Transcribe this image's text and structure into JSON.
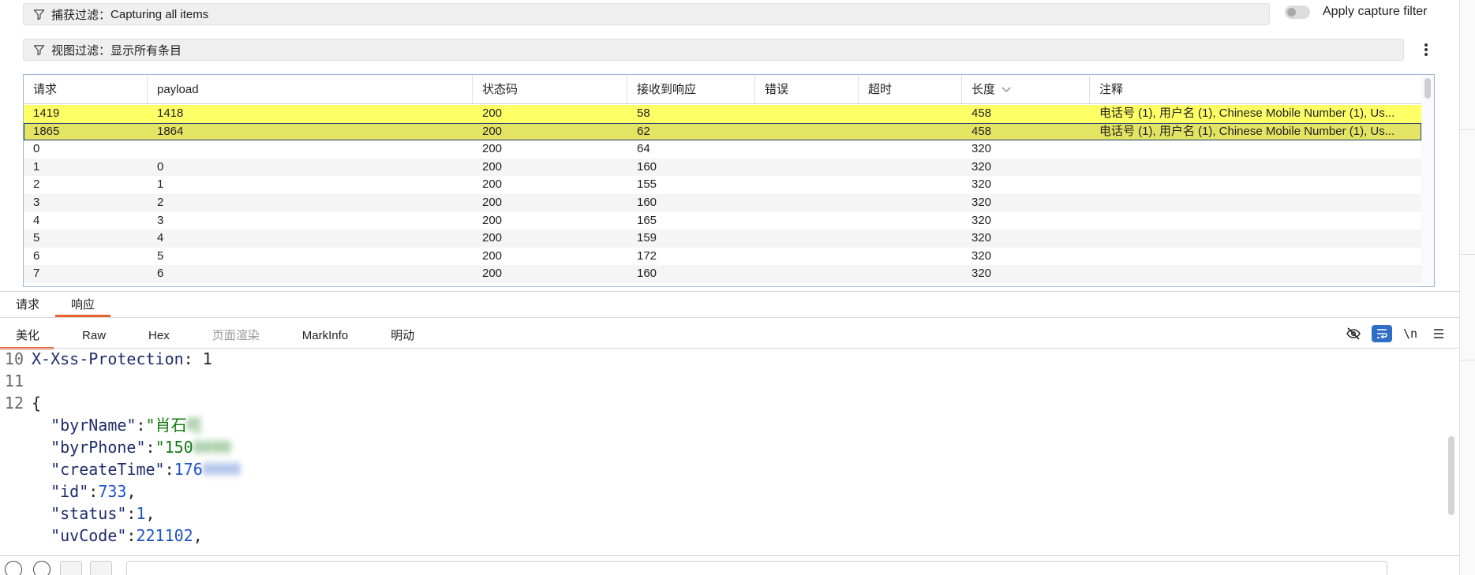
{
  "capture_filter": {
    "label": "捕获过滤：",
    "value": "Capturing all items"
  },
  "apply_capture_filter": {
    "label": "Apply capture filter"
  },
  "view_filter": {
    "label": "视图过滤：",
    "value": "显示所有条目"
  },
  "table": {
    "headers": [
      "请求",
      "payload",
      "状态码",
      "接收到响应",
      "错误",
      "超时",
      "长度",
      "注释"
    ],
    "sort_column": "长度",
    "rows": [
      {
        "req": "1419",
        "payload": "1418",
        "status": "200",
        "resp": "58",
        "err": "",
        "timeout": "",
        "len": "458",
        "note": "电话号 (1), 用户名 (1), Chinese Mobile Number (1), Us...",
        "style": "hl"
      },
      {
        "req": "1865",
        "payload": "1864",
        "status": "200",
        "resp": "62",
        "err": "",
        "timeout": "",
        "len": "458",
        "note": "电话号 (1), 用户名 (1), Chinese Mobile Number (1), Us...",
        "style": "sel"
      },
      {
        "req": "0",
        "payload": "",
        "status": "200",
        "resp": "64",
        "err": "",
        "timeout": "",
        "len": "320",
        "note": "",
        "style": ""
      },
      {
        "req": "1",
        "payload": "0",
        "status": "200",
        "resp": "160",
        "err": "",
        "timeout": "",
        "len": "320",
        "note": "",
        "style": ""
      },
      {
        "req": "2",
        "payload": "1",
        "status": "200",
        "resp": "155",
        "err": "",
        "timeout": "",
        "len": "320",
        "note": "",
        "style": ""
      },
      {
        "req": "3",
        "payload": "2",
        "status": "200",
        "resp": "160",
        "err": "",
        "timeout": "",
        "len": "320",
        "note": "",
        "style": ""
      },
      {
        "req": "4",
        "payload": "3",
        "status": "200",
        "resp": "165",
        "err": "",
        "timeout": "",
        "len": "320",
        "note": "",
        "style": ""
      },
      {
        "req": "5",
        "payload": "4",
        "status": "200",
        "resp": "159",
        "err": "",
        "timeout": "",
        "len": "320",
        "note": "",
        "style": ""
      },
      {
        "req": "6",
        "payload": "5",
        "status": "200",
        "resp": "172",
        "err": "",
        "timeout": "",
        "len": "320",
        "note": "",
        "style": ""
      },
      {
        "req": "7",
        "payload": "6",
        "status": "200",
        "resp": "160",
        "err": "",
        "timeout": "",
        "len": "320",
        "note": "",
        "style": ""
      }
    ]
  },
  "tabs": {
    "request": "请求",
    "response": "响应"
  },
  "subtabs": {
    "pretty": "美化",
    "raw": "Raw",
    "hex": "Hex",
    "render": "页面渲染",
    "markinfo": "MarkInfo",
    "explain": "明动"
  },
  "toolbar": {
    "newline_label": "\\n"
  },
  "editor": {
    "ln10": "10",
    "ln11": "11",
    "ln12": "12",
    "header_key": "X-Xss-Protection",
    "header_val": "1",
    "brace_open": "{",
    "byrName_key": "\"byrName\"",
    "byrName_val": "\"肖石",
    "byrName_blur": "旺",
    "byrPhone_key": "\"byrPhone\"",
    "byrPhone_val": "\"150",
    "byrPhone_blur": "0000",
    "createTime_key": "\"createTime\"",
    "createTime_val": "176",
    "createTime_blur": "0000",
    "id_key": "\"id\"",
    "id_val": "733",
    "status_key": "\"status\"",
    "status_val": "1",
    "uvCode_key": "\"uvCode\"",
    "uvCode_val": "221102"
  },
  "colors": {
    "highlight": "#ffff66",
    "selected": "#e4e464",
    "accent": "#e8602c",
    "toggle_on": "#2f6ec5"
  }
}
